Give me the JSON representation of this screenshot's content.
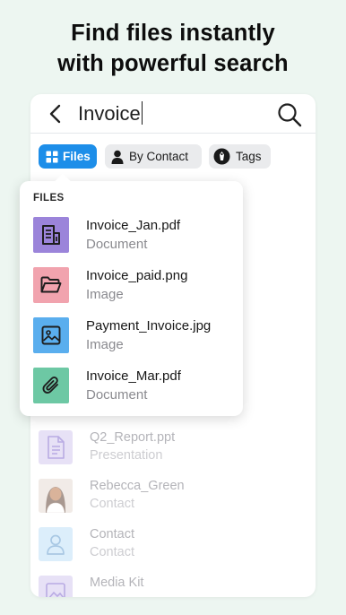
{
  "headline": {
    "line1": "Find files instantly",
    "line2": "with powerful search"
  },
  "search": {
    "query": "Invoice"
  },
  "filters": [
    {
      "label": "Files",
      "icon": "grid-icon",
      "active": true
    },
    {
      "label": "By Contact",
      "icon": "person-icon",
      "active": false
    },
    {
      "label": "Tags",
      "icon": "tag-icon",
      "active": false
    }
  ],
  "dropdown": {
    "title": "FILES",
    "items": [
      {
        "name": "Invoice_Jan.pdf",
        "type": "Document",
        "icon": "document-icon",
        "color": "#9b84da"
      },
      {
        "name": "Invoice_paid.png",
        "type": "Image",
        "icon": "folder-icon",
        "color": "#f1a3ae"
      },
      {
        "name": "Payment_Invoice.jpg",
        "type": "Image",
        "icon": "image-icon",
        "color": "#5aaeee"
      },
      {
        "name": "Invoice_Mar.pdf",
        "type": "Document",
        "icon": "paperclip-icon",
        "color": "#6dc8a4"
      }
    ]
  },
  "results": [
    {
      "name": "Q2_Report.ppt",
      "type": "Presentation",
      "icon": "document-icon"
    },
    {
      "name": "Rebecca_Green",
      "type": "Contact",
      "icon": "contact-photo"
    },
    {
      "name": "Contact",
      "type": "Contact",
      "icon": "person-icon"
    },
    {
      "name": "Media Kit",
      "type": "",
      "icon": "image-icon"
    }
  ],
  "colors": {
    "accent": "#1d8ee9",
    "background": "#edf6f1"
  }
}
